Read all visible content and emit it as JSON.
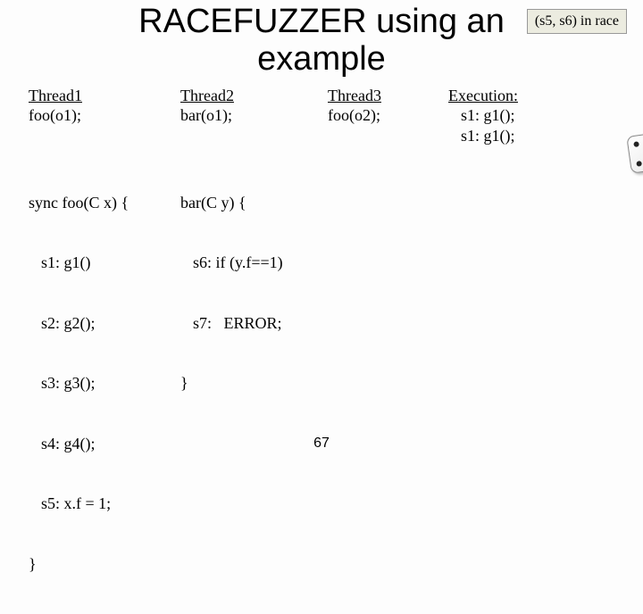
{
  "title_line1": "RACEFUZZER using an",
  "title_line2": "example",
  "race_badge": "(s5, s6) in race",
  "thread1": {
    "header": "Thread1",
    "call": "foo(o1);"
  },
  "thread2": {
    "header": "Thread2",
    "call": "bar(o1);"
  },
  "thread3": {
    "header": "Thread3",
    "call": "foo(o2);"
  },
  "foo": {
    "sig": "sync foo(C x) {",
    "s1": "s1: g1()",
    "s2": "s2: g2();",
    "s3": "s3: g3();",
    "s4": "s4: g4();",
    "s5": "s5: x.f = 1;",
    "close": "}"
  },
  "bar": {
    "sig": "bar(C y) {",
    "s6": "s6: if (y.f==1)",
    "s7": "s7:   ERROR;",
    "close": "}"
  },
  "execution": {
    "header": "Execution:",
    "e1": "s1: g1();",
    "e2": "s1: g1();"
  },
  "page_number": "67"
}
